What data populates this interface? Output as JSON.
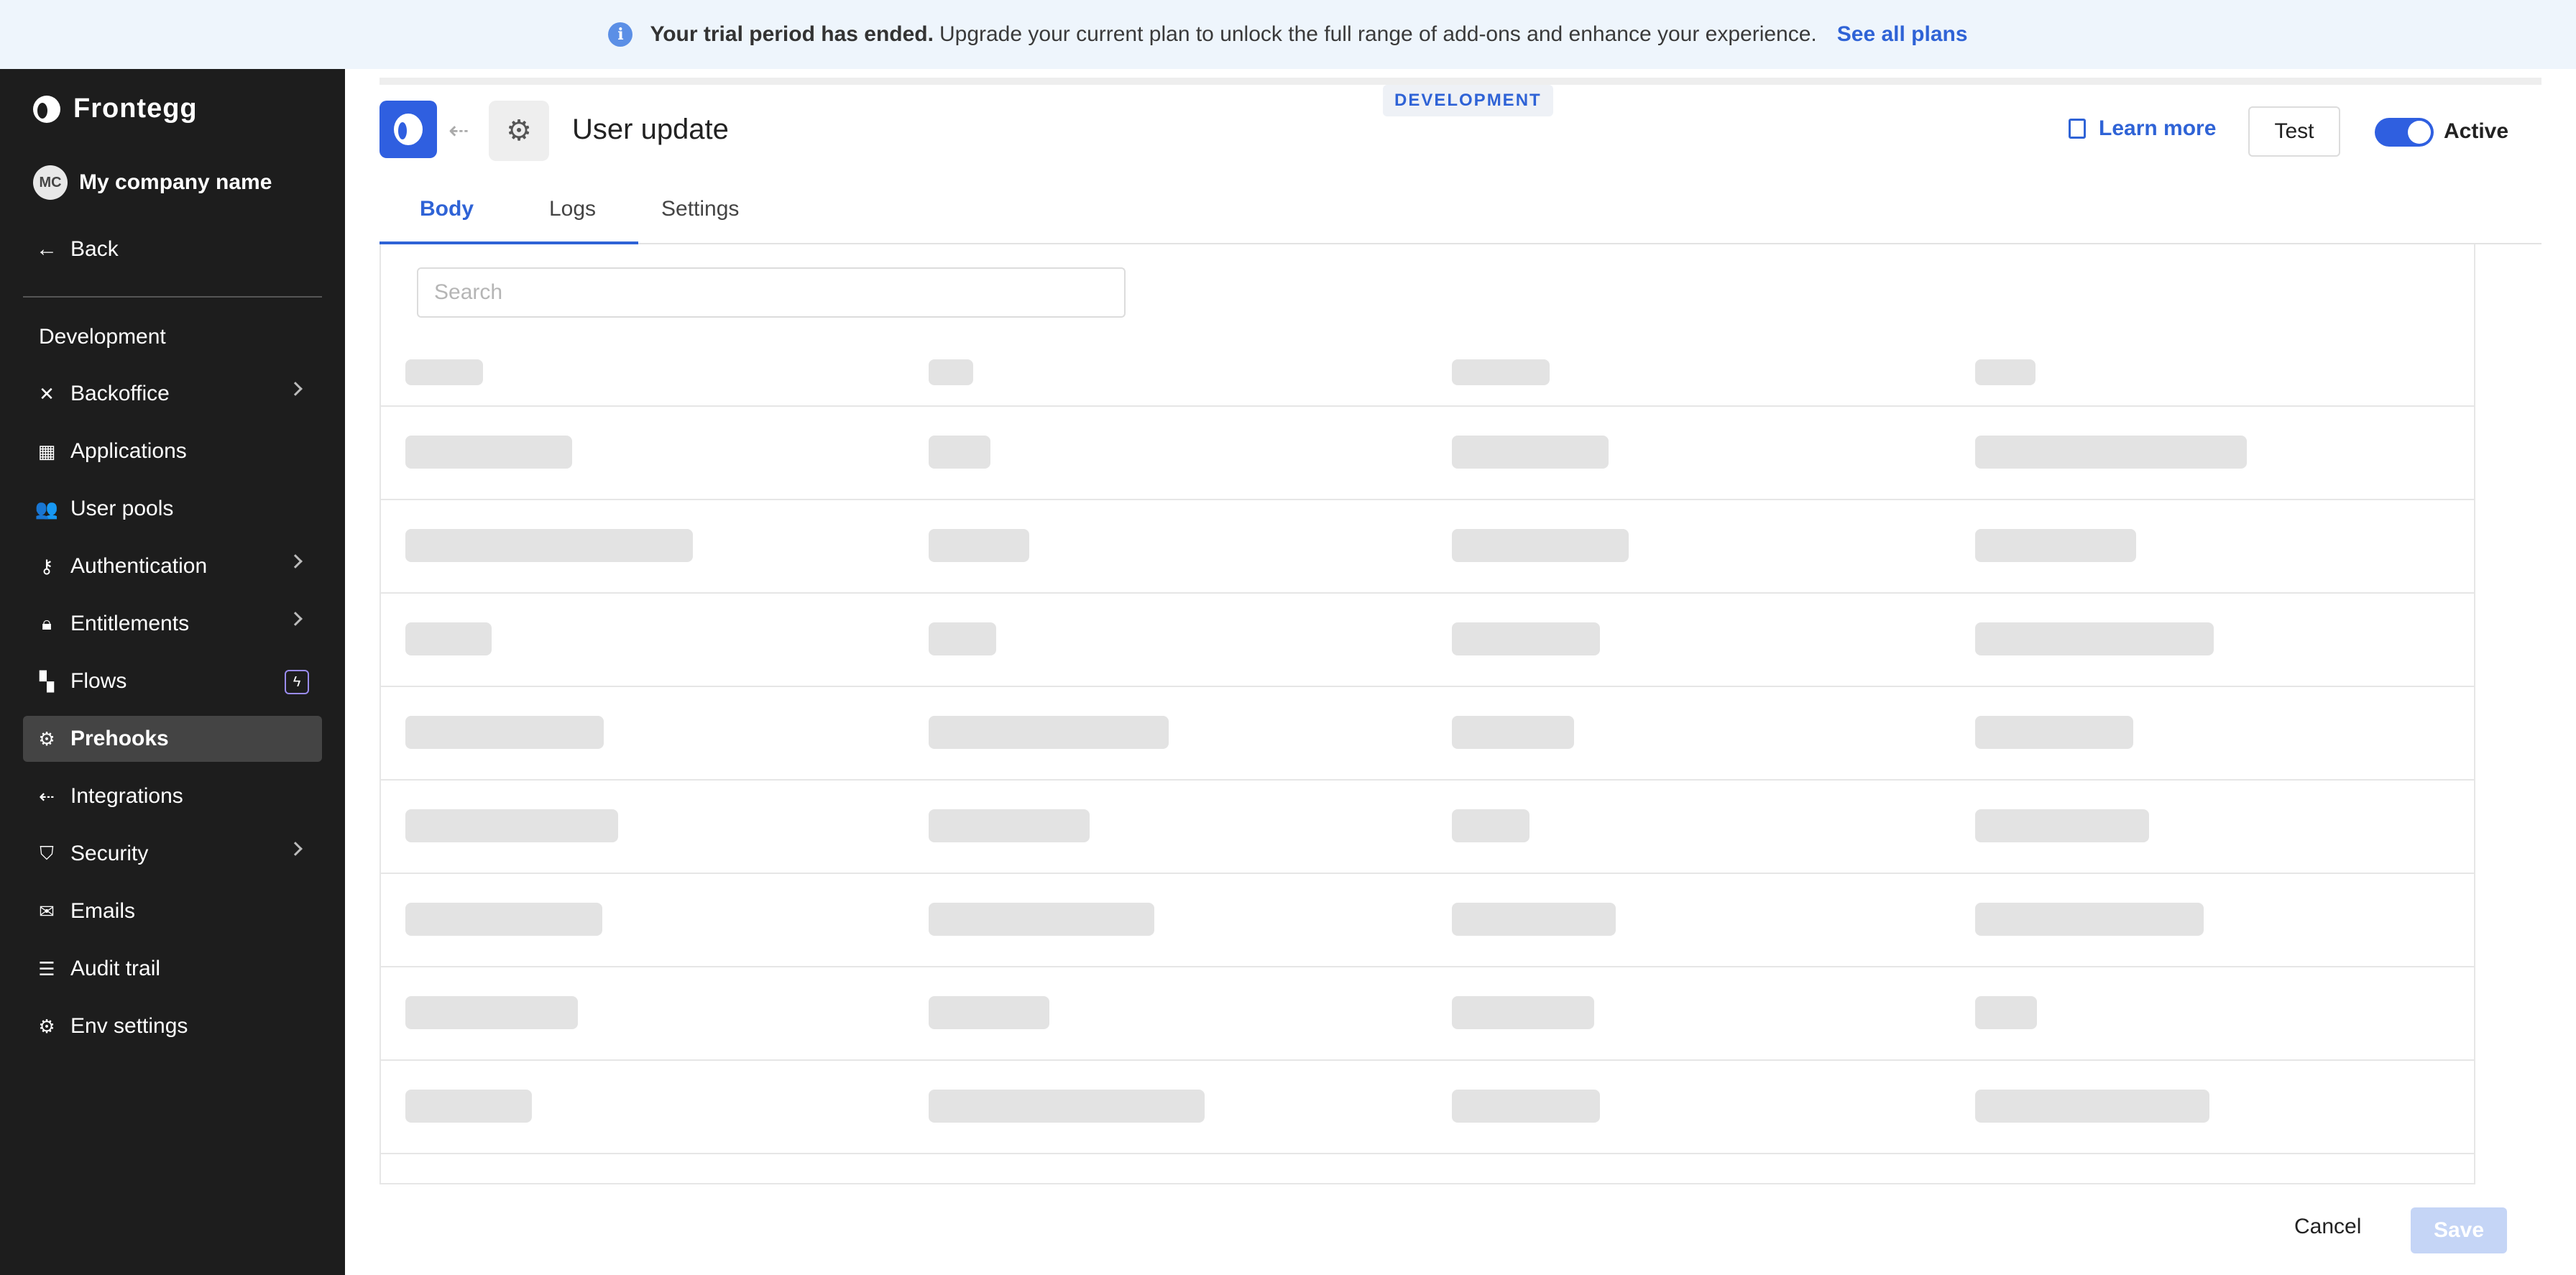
{
  "banner": {
    "bold": "Your trial period has ended.",
    "text": "Upgrade your current plan to unlock the full range of add-ons and enhance your experience.",
    "link": "See all plans"
  },
  "sidebar": {
    "logo": "Frontegg",
    "company": {
      "initials": "MC",
      "name": "My company name"
    },
    "back": "Back",
    "section": "Development",
    "items": [
      {
        "label": "Backoffice",
        "icon": "tools-icon"
      },
      {
        "label": "Applications",
        "icon": "grid-icon"
      },
      {
        "label": "User pools",
        "icon": "users-icon"
      },
      {
        "label": "Authentication",
        "icon": "key-icon"
      },
      {
        "label": "Entitlements",
        "icon": "lock-icon"
      },
      {
        "label": "Flows",
        "icon": "flow-icon"
      },
      {
        "label": "Prehooks",
        "icon": "prehook-icon"
      },
      {
        "label": "Integrations",
        "icon": "integration-icon"
      },
      {
        "label": "Security",
        "icon": "shield-icon"
      },
      {
        "label": "Emails",
        "icon": "mail-icon"
      },
      {
        "label": "Audit trail",
        "icon": "list-icon"
      },
      {
        "label": "Env settings",
        "icon": "gear-icon"
      }
    ]
  },
  "header": {
    "env": "DEVELOPMENT",
    "title": "User update",
    "learn_more": "Learn more",
    "test": "Test",
    "toggle_label": "Active"
  },
  "tabs": [
    "Body",
    "Logs",
    "Settings"
  ],
  "search": {
    "placeholder": "Search"
  },
  "footer": {
    "cancel": "Cancel",
    "save": "Save"
  }
}
